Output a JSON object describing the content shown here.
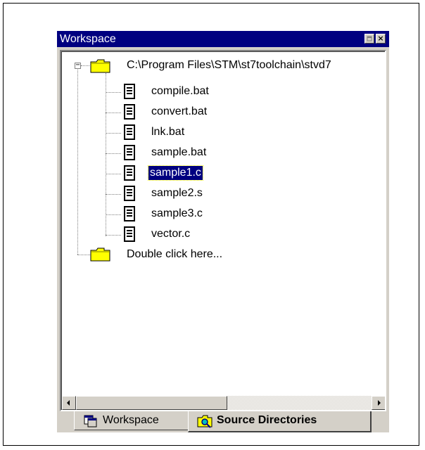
{
  "window": {
    "title": "Workspace",
    "controls": {
      "restore_icon": "restore-icon",
      "close_glyph": "×"
    }
  },
  "tree": {
    "root": {
      "label": "C:\\Program Files\\STM\\st7toolchain\\stvd7",
      "expanded": true,
      "expander_glyph": "−"
    },
    "files": [
      {
        "label": "compile.bat",
        "selected": false
      },
      {
        "label": "convert.bat",
        "selected": false
      },
      {
        "label": "lnk.bat",
        "selected": false
      },
      {
        "label": "sample.bat",
        "selected": false
      },
      {
        "label": "sample1.c",
        "selected": true
      },
      {
        "label": "sample2.s",
        "selected": false
      },
      {
        "label": "sample3.c",
        "selected": false
      },
      {
        "label": "vector.c",
        "selected": false
      }
    ],
    "add_item": {
      "label": "Double click here..."
    }
  },
  "tabs": [
    {
      "label": "Workspace",
      "active": false,
      "icon": "workspace-icon"
    },
    {
      "label": "Source Directories",
      "active": true,
      "icon": "source-directories-icon"
    }
  ],
  "colors": {
    "titlebar": "#000080",
    "face": "#d4d0c8",
    "selection": "#000080",
    "folder": "#ffff00"
  }
}
